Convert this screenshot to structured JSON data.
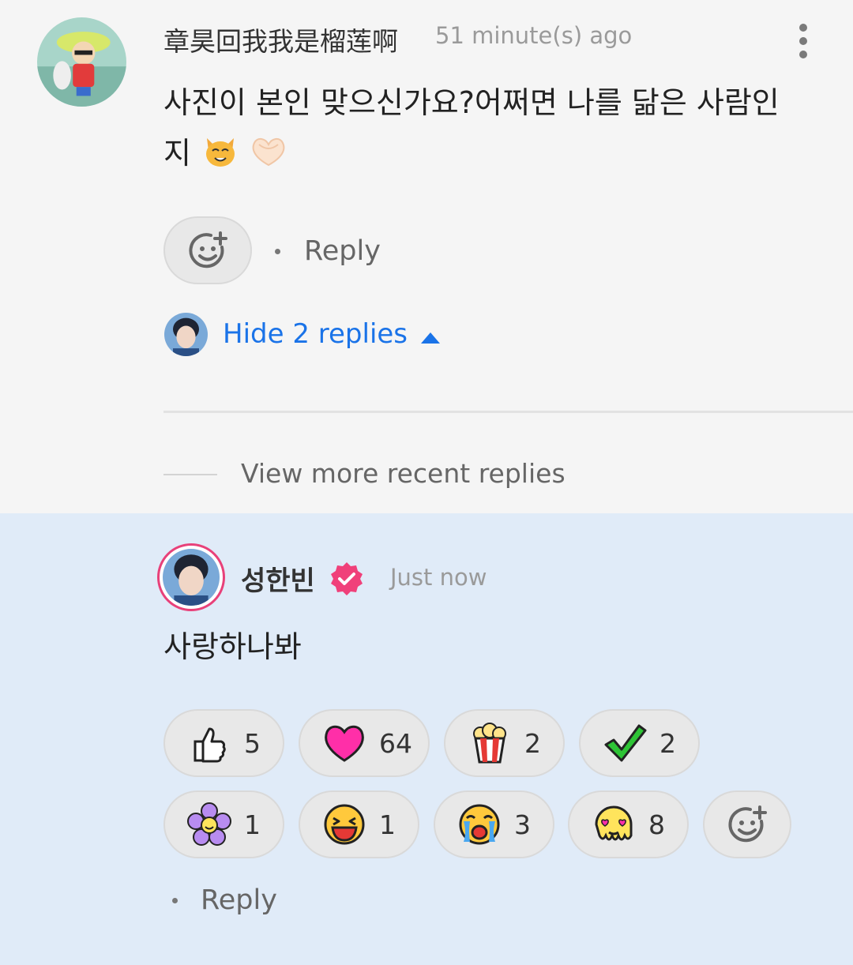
{
  "comment": {
    "author": "章昊回我我是榴莲啊",
    "time": "51 minute(s) ago",
    "text_line1": "사진이 본인 맞으신가요?어쩌면 나를 닮은 사람인",
    "text_line2": "지",
    "emojis": [
      "cat-face-emoji",
      "heart-hands-emoji"
    ],
    "reply_label": "Reply",
    "hide_replies": "Hide 2 replies",
    "more_replies": "View more recent replies"
  },
  "reply": {
    "author": "성한빈",
    "verified": true,
    "time": "Just now",
    "text": "사랑하나봐",
    "reactions": [
      {
        "icon": "thumbs-up-icon",
        "count": "5"
      },
      {
        "icon": "heart-icon",
        "count": "64"
      },
      {
        "icon": "popcorn-icon",
        "count": "2"
      },
      {
        "icon": "check-mark-icon",
        "count": "2"
      },
      {
        "icon": "flower-icon",
        "count": "1"
      },
      {
        "icon": "laughing-face-icon",
        "count": "1"
      },
      {
        "icon": "crying-face-icon",
        "count": "3"
      },
      {
        "icon": "heart-eyes-melting-icon",
        "count": "8"
      }
    ],
    "reply_label": "Reply"
  },
  "colors": {
    "link": "#1a73e8",
    "reply_bg": "#e0ebf8",
    "verified_badge": "#f0407a",
    "artist_ring": "#e8417a"
  }
}
